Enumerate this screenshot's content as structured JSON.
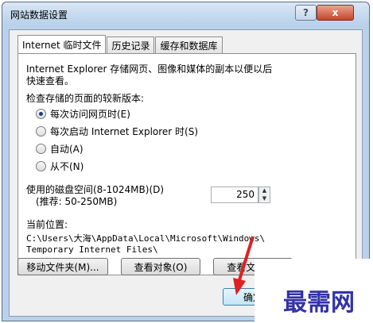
{
  "window": {
    "title": "网站数据设置",
    "help_label": "?",
    "close_label": "x"
  },
  "tabs": [
    {
      "label": "Internet 临时文件"
    },
    {
      "label": "历史记录"
    },
    {
      "label": "缓存和数据库"
    }
  ],
  "panel": {
    "description_line1": "Internet Explorer 存储网页、图像和媒体的副本以便以后",
    "description_line2": "快速查看。",
    "check_label": "检查存储的页面的较新版本:",
    "radios": [
      {
        "label": "每次访问网页时(E)",
        "checked": true
      },
      {
        "label": "每次启动 Internet Explorer 时(S)",
        "checked": false
      },
      {
        "label": "自动(A)",
        "checked": false
      },
      {
        "label": "从不(N)",
        "checked": false
      }
    ],
    "disk_label_line1": "使用的磁盘空间(8-1024MB)(D)",
    "disk_label_line2": "(推荐: 50-250MB)",
    "disk_value": "250",
    "location_label": "当前位置:",
    "location_path_line1": "C:\\Users\\大海\\AppData\\Local\\Microsoft\\Windows\\",
    "location_path_line2": "Temporary Internet Files\\",
    "buttons": {
      "move_folder": "移动文件夹(M)...",
      "view_objects": "查看对象(O)",
      "view_files": "查看文件(V)"
    }
  },
  "footer": {
    "ok_label": "确定"
  },
  "watermark": "最需网"
}
